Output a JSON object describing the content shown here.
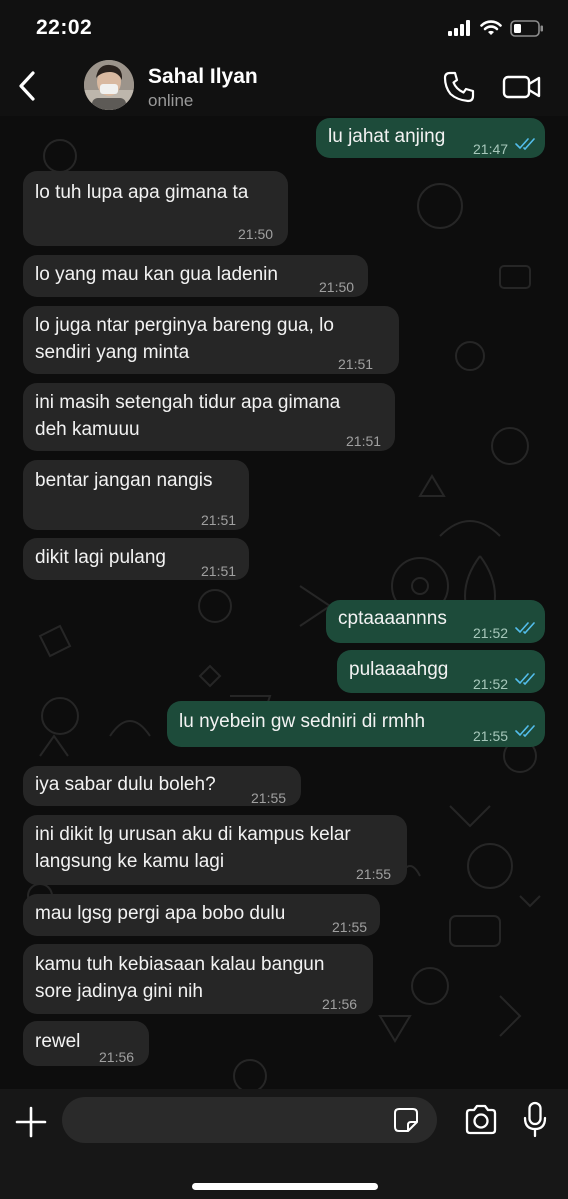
{
  "status_bar": {
    "time": "22:02"
  },
  "header": {
    "name": "Sahal Ilyan",
    "status": "online"
  },
  "messages": [
    {
      "text": "lu jahat anjing",
      "time": "21:47",
      "direction": "out"
    },
    {
      "text": "lo tuh lupa apa gimana ta",
      "time": "21:50",
      "direction": "in"
    },
    {
      "text": "lo yang mau kan gua ladenin",
      "time": "21:50",
      "direction": "in"
    },
    {
      "line1": "lo juga ntar perginya bareng gua, lo",
      "line2": "sendiri yang minta",
      "time": "21:51",
      "direction": "in"
    },
    {
      "line1": "ini masih setengah tidur apa gimana",
      "line2": "deh kamuuu",
      "time": "21:51",
      "direction": "in"
    },
    {
      "text": "bentar jangan nangis",
      "time": "21:51",
      "direction": "in"
    },
    {
      "text": "dikit lagi pulang",
      "time": "21:51",
      "direction": "in"
    },
    {
      "text": "cptaaaannns",
      "time": "21:52",
      "direction": "out"
    },
    {
      "text": "pulaaaahgg",
      "time": "21:52",
      "direction": "out"
    },
    {
      "text": "lu nyebein gw sedniri di rmhh",
      "time": "21:55",
      "direction": "out"
    },
    {
      "text": "iya sabar dulu boleh?",
      "time": "21:55",
      "direction": "in"
    },
    {
      "line1": "ini dikit lg urusan aku di kampus kelar",
      "line2": "langsung ke kamu lagi",
      "time": "21:55",
      "direction": "in"
    },
    {
      "text": "mau lgsg pergi apa bobo dulu",
      "time": "21:55",
      "direction": "in"
    },
    {
      "line1": "kamu tuh kebiasaan kalau bangun",
      "line2": "sore jadinya gini nih",
      "time": "21:56",
      "direction": "in"
    },
    {
      "text": "rewel",
      "time": "21:56",
      "direction": "in"
    }
  ],
  "composer": {
    "placeholder": ""
  },
  "colors": {
    "incoming_bubble": "#262626",
    "outgoing_bubble": "#1d4b3a",
    "read_ticks": "#53bdeb"
  },
  "icons": [
    "back-icon",
    "phone-icon",
    "video-camera-icon",
    "plus-icon",
    "sticker-icon",
    "camera-icon",
    "microphone-icon"
  ]
}
